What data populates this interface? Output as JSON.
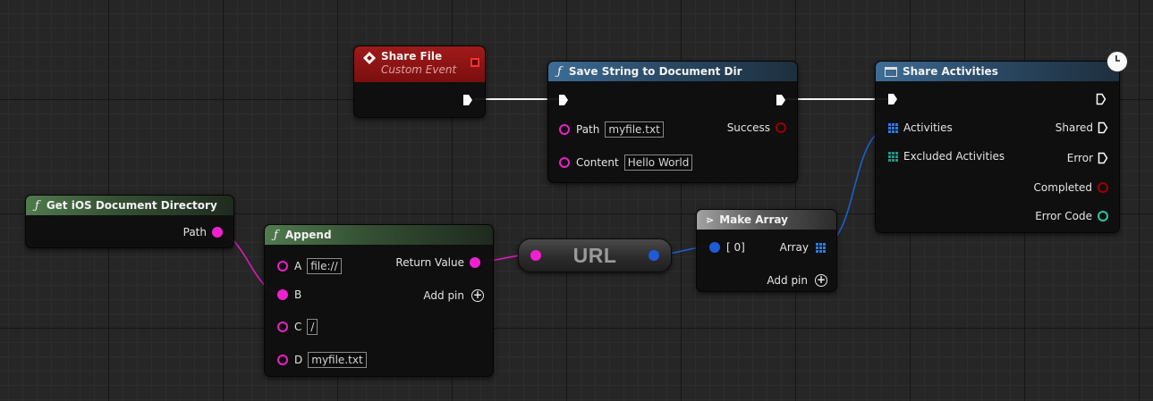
{
  "nodes": {
    "share_file": {
      "title": "Share File",
      "subtitle": "Custom Event"
    },
    "save_string": {
      "title": "Save String to Document Dir",
      "path_label": "Path",
      "path_value": "myfile.txt",
      "content_label": "Content",
      "content_value": "Hello World",
      "success_label": "Success"
    },
    "share_activities": {
      "title": "Share Activities",
      "activities_label": "Activities",
      "excluded_label": "Excluded Activities",
      "shared_label": "Shared",
      "error_label": "Error",
      "completed_label": "Completed",
      "error_code_label": "Error Code"
    },
    "get_ios_dir": {
      "title": "Get iOS Document Directory",
      "path_label": "Path"
    },
    "append": {
      "title": "Append",
      "a_label": "A",
      "a_value": "file://",
      "b_label": "B",
      "c_label": "C",
      "c_value": "/",
      "d_label": "D",
      "d_value": "myfile.txt",
      "return_label": "Return Value",
      "add_pin_label": "Add pin"
    },
    "url_var": {
      "label": "URL"
    },
    "make_array": {
      "title": "Make Array",
      "index_label": "[ 0]",
      "array_label": "Array",
      "add_pin_label": "Add pin"
    }
  },
  "colors": {
    "exec_wire": "#ffffff",
    "string_wire": "#e01fc0",
    "object_wire": "#1d5fd4",
    "event_header": "#8a1414",
    "function_header": "#2a4a66",
    "pure_header": "#344f33"
  }
}
